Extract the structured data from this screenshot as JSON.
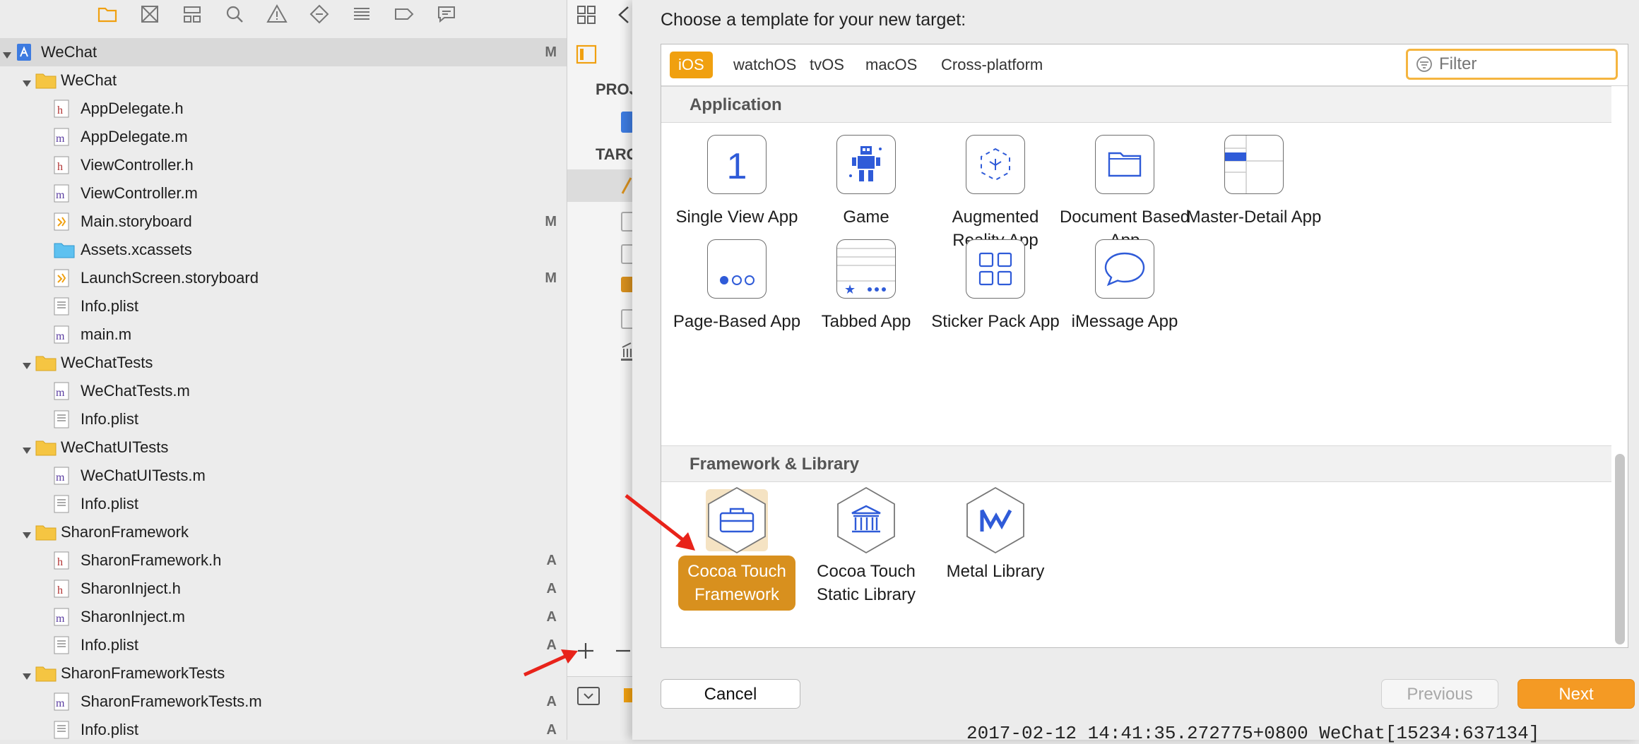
{
  "navigator": {
    "tree": [
      {
        "label": "WeChat",
        "type": "project",
        "level": 0,
        "badge": "M"
      },
      {
        "label": "WeChat",
        "type": "folder",
        "level": 1,
        "badge": ""
      },
      {
        "label": "AppDelegate.h",
        "type": "h",
        "level": 2,
        "badge": ""
      },
      {
        "label": "AppDelegate.m",
        "type": "m",
        "level": 2,
        "badge": ""
      },
      {
        "label": "ViewController.h",
        "type": "h",
        "level": 2,
        "badge": ""
      },
      {
        "label": "ViewController.m",
        "type": "m",
        "level": 2,
        "badge": ""
      },
      {
        "label": "Main.storyboard",
        "type": "storyboard",
        "level": 2,
        "badge": "M"
      },
      {
        "label": "Assets.xcassets",
        "type": "assets",
        "level": 2,
        "badge": ""
      },
      {
        "label": "LaunchScreen.storyboard",
        "type": "storyboard",
        "level": 2,
        "badge": "M"
      },
      {
        "label": "Info.plist",
        "type": "plist",
        "level": 2,
        "badge": ""
      },
      {
        "label": "main.m",
        "type": "m",
        "level": 2,
        "badge": ""
      },
      {
        "label": "WeChatTests",
        "type": "folder",
        "level": 1,
        "badge": ""
      },
      {
        "label": "WeChatTests.m",
        "type": "m",
        "level": 2,
        "badge": ""
      },
      {
        "label": "Info.plist",
        "type": "plist",
        "level": 2,
        "badge": ""
      },
      {
        "label": "WeChatUITests",
        "type": "folder",
        "level": 1,
        "badge": ""
      },
      {
        "label": "WeChatUITests.m",
        "type": "m",
        "level": 2,
        "badge": ""
      },
      {
        "label": "Info.plist",
        "type": "plist",
        "level": 2,
        "badge": ""
      },
      {
        "label": "SharonFramework",
        "type": "folder",
        "level": 1,
        "badge": ""
      },
      {
        "label": "SharonFramework.h",
        "type": "h",
        "level": 2,
        "badge": "A"
      },
      {
        "label": "SharonInject.h",
        "type": "h",
        "level": 2,
        "badge": "A"
      },
      {
        "label": "SharonInject.m",
        "type": "m",
        "level": 2,
        "badge": "A"
      },
      {
        "label": "Info.plist",
        "type": "plist",
        "level": 2,
        "badge": "A"
      },
      {
        "label": "SharonFrameworkTests",
        "type": "folder",
        "level": 1,
        "badge": ""
      },
      {
        "label": "SharonFrameworkTests.m",
        "type": "m",
        "level": 2,
        "badge": "A"
      },
      {
        "label": "Info.plist",
        "type": "plist",
        "level": 2,
        "badge": "A"
      }
    ]
  },
  "middle": {
    "project_header": "PROJ",
    "targets_header": "TARG"
  },
  "sheet": {
    "title": "Choose a template for your new target:",
    "platform_tabs": [
      "iOS",
      "watchOS",
      "tvOS",
      "macOS",
      "Cross-platform"
    ],
    "active_tab": "iOS",
    "filter_placeholder": "Filter",
    "sections": {
      "application": "Application",
      "framework": "Framework & Library"
    },
    "application_templates": [
      {
        "label": "Single View App",
        "icon": "single-view-app-icon"
      },
      {
        "label": "Game",
        "icon": "game-icon"
      },
      {
        "label": "Augmented\nReality App",
        "icon": "augmented-reality-icon"
      },
      {
        "label": "Document Based\nApp",
        "icon": "document-based-icon"
      },
      {
        "label": "Master-Detail App",
        "icon": "master-detail-icon"
      },
      {
        "label": "Page-Based App",
        "icon": "page-based-icon"
      },
      {
        "label": "Tabbed App",
        "icon": "tabbed-app-icon"
      },
      {
        "label": "Sticker Pack App",
        "icon": "sticker-pack-icon"
      },
      {
        "label": "iMessage App",
        "icon": "imessage-icon"
      }
    ],
    "framework_templates": [
      {
        "label": "Cocoa Touch\nFramework",
        "icon": "toolbox-icon",
        "selected": true
      },
      {
        "label": "Cocoa Touch\nStatic Library",
        "icon": "library-building-icon",
        "selected": false
      },
      {
        "label": "Metal Library",
        "icon": "metal-icon",
        "selected": false
      }
    ],
    "single_view_glyph": "1",
    "buttons": {
      "cancel": "Cancel",
      "previous": "Previous",
      "next": "Next"
    },
    "colors": {
      "accent": "#f0a010",
      "selected_label": "#d8901e",
      "selected_bg": "#f5e3c3",
      "icon_blue": "#2f5bd8",
      "annotation_red": "#e8231a"
    }
  },
  "console_text": "2017-02-12 14:41:35.272775+0800 WeChat[15234:637134]"
}
